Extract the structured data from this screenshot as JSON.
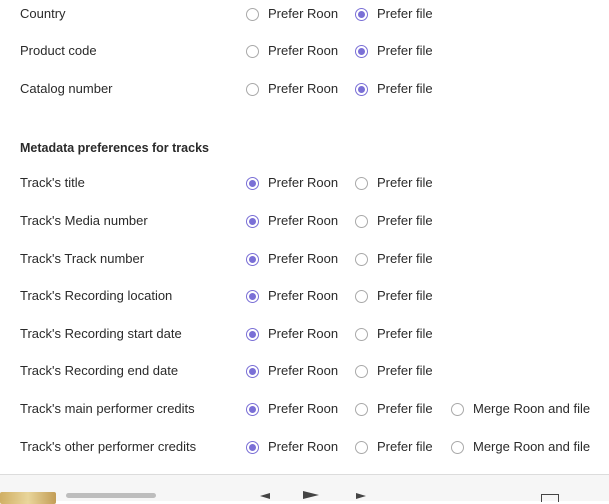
{
  "album_rows": [
    {
      "label": "Country",
      "selected": "file"
    },
    {
      "label": "Product code",
      "selected": "file"
    },
    {
      "label": "Catalog number",
      "selected": "file"
    }
  ],
  "options": {
    "prefer_roon": "Prefer Roon",
    "prefer_file": "Prefer file",
    "merge": "Merge Roon and file"
  },
  "tracks_section": {
    "title": "Metadata preferences for tracks",
    "rows": [
      {
        "label": "Track's title",
        "selected": "roon",
        "merge": false
      },
      {
        "label": "Track's Media number",
        "selected": "roon",
        "merge": false
      },
      {
        "label": "Track's Track number",
        "selected": "roon",
        "merge": false
      },
      {
        "label": "Track's Recording location",
        "selected": "roon",
        "merge": false
      },
      {
        "label": "Track's Recording start date",
        "selected": "roon",
        "merge": false
      },
      {
        "label": "Track's Recording end date",
        "selected": "roon",
        "merge": false
      },
      {
        "label": "Track's main performer credits",
        "selected": "roon",
        "merge": true
      },
      {
        "label": "Track's other performer credits",
        "selected": "roon",
        "merge": true
      }
    ]
  },
  "colors": {
    "accent": "#7a6fd6",
    "radio_border": "#a9a9a9"
  }
}
